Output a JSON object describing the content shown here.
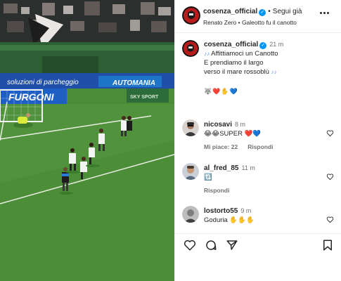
{
  "header": {
    "username": "cosenza_official",
    "dot": "•",
    "follow_label": "Segui già",
    "audio": "Renato Zero • Galeotto fu il canotto"
  },
  "caption": {
    "username": "cosenza_official",
    "time": "21 m",
    "line1": "Affittiamoci un Canotto",
    "line2": "E prendiamo il largo",
    "line3": "verso il mare rossoblù",
    "note_icon": "♪♪",
    "emojis": "🐺❤️✋💙"
  },
  "comments": [
    {
      "username": "nicosavi",
      "time": "8 m",
      "text": "😂😂SUPER ❤️💙",
      "likes": "Mi piace: 22",
      "reply": "Rispondi"
    },
    {
      "username": "al_fred_85",
      "time": "11 m",
      "text": "🔃",
      "reply": "Rispondi"
    },
    {
      "username": "lostorto55",
      "time": "9 m",
      "text": "Goduria ✋✋✋"
    }
  ],
  "media": {
    "ad_boards": [
      "soluzioni di parcheggio",
      "FURGONI",
      "AUTOMANIA",
      "SKY SPORT"
    ]
  },
  "colors": {
    "accent": "#0095f6",
    "pitch": "#4b8c38",
    "club": "#b71c1c"
  }
}
